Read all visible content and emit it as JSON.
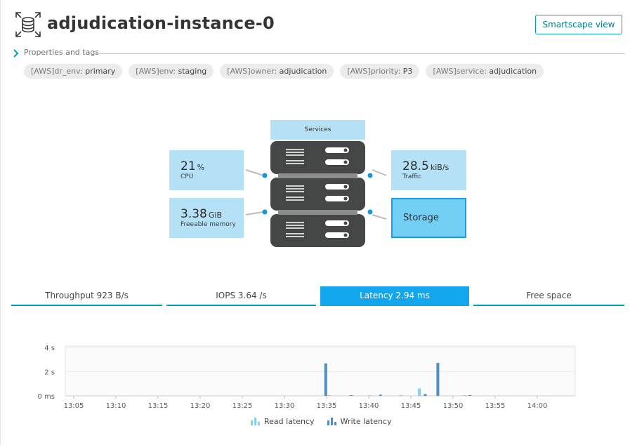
{
  "header": {
    "title": "adjudication-instance-0",
    "icon": "database-instance-icon",
    "smartscape_label": "Smartscape view"
  },
  "properties": {
    "label": "Properties and tags",
    "tags": [
      {
        "key": "[AWS]dr_env:",
        "value": "primary"
      },
      {
        "key": "[AWS]env:",
        "value": "staging"
      },
      {
        "key": "[AWS]owner:",
        "value": "adjudication"
      },
      {
        "key": "[AWS]priority:",
        "value": "P3"
      },
      {
        "key": "[AWS]service:",
        "value": "adjudication"
      }
    ]
  },
  "infographic": {
    "services_label": "Services",
    "cpu": {
      "value": "21",
      "unit": "%",
      "label": "CPU"
    },
    "memory": {
      "value": "3.38",
      "unit": "GiB",
      "label": "Freeable memory"
    },
    "traffic": {
      "value": "28.5",
      "unit": "kiB/s",
      "label": "Traffic"
    },
    "storage": {
      "label": "Storage"
    }
  },
  "tabs": [
    {
      "label": "Throughput 923 B/s",
      "active": false
    },
    {
      "label": "IOPS 3.64 /s",
      "active": false
    },
    {
      "label": "Latency 2.94 ms",
      "active": true
    },
    {
      "label": "Free space",
      "active": false
    }
  ],
  "colors": {
    "accent_teal": "#00a1b2",
    "active_tab": "#12a6ec",
    "read_latency": "#7dd3f4",
    "write_latency": "#4b8fc6",
    "server_dark": "#454646",
    "tile_blue": "#b5e1f7"
  },
  "chart_data": {
    "type": "bar",
    "y_ticks": [
      "4 s",
      "2 s",
      "0 ms"
    ],
    "ylim": [
      0,
      4
    ],
    "y_unit": "s",
    "x_ticks": [
      "13:05",
      "13:10",
      "13:15",
      "13:20",
      "13:25",
      "13:30",
      "13:35",
      "13:40",
      "13:45",
      "13:50",
      "13:55",
      "14:00"
    ],
    "x_minutes": [
      0,
      5,
      10,
      15,
      20,
      25,
      30,
      35,
      40,
      45,
      50,
      55
    ],
    "xlim_minutes": [
      -1,
      59.5
    ],
    "series": [
      {
        "name": "Read latency",
        "color": "#7dd3f4",
        "points": [
          [
            30.3,
            0.04
          ],
          [
            33.0,
            0.03
          ],
          [
            35.2,
            0.05
          ],
          [
            38.8,
            0.07
          ],
          [
            41.0,
            0.6
          ],
          [
            46.4,
            0.02
          ]
        ]
      },
      {
        "name": "Write latency",
        "color": "#4b8fc6",
        "points": [
          [
            29.9,
            2.68
          ],
          [
            32.9,
            0.04
          ],
          [
            36.4,
            0.1
          ],
          [
            41.7,
            0.15
          ],
          [
            43.2,
            2.72
          ],
          [
            47.0,
            0.03
          ]
        ]
      }
    ]
  }
}
